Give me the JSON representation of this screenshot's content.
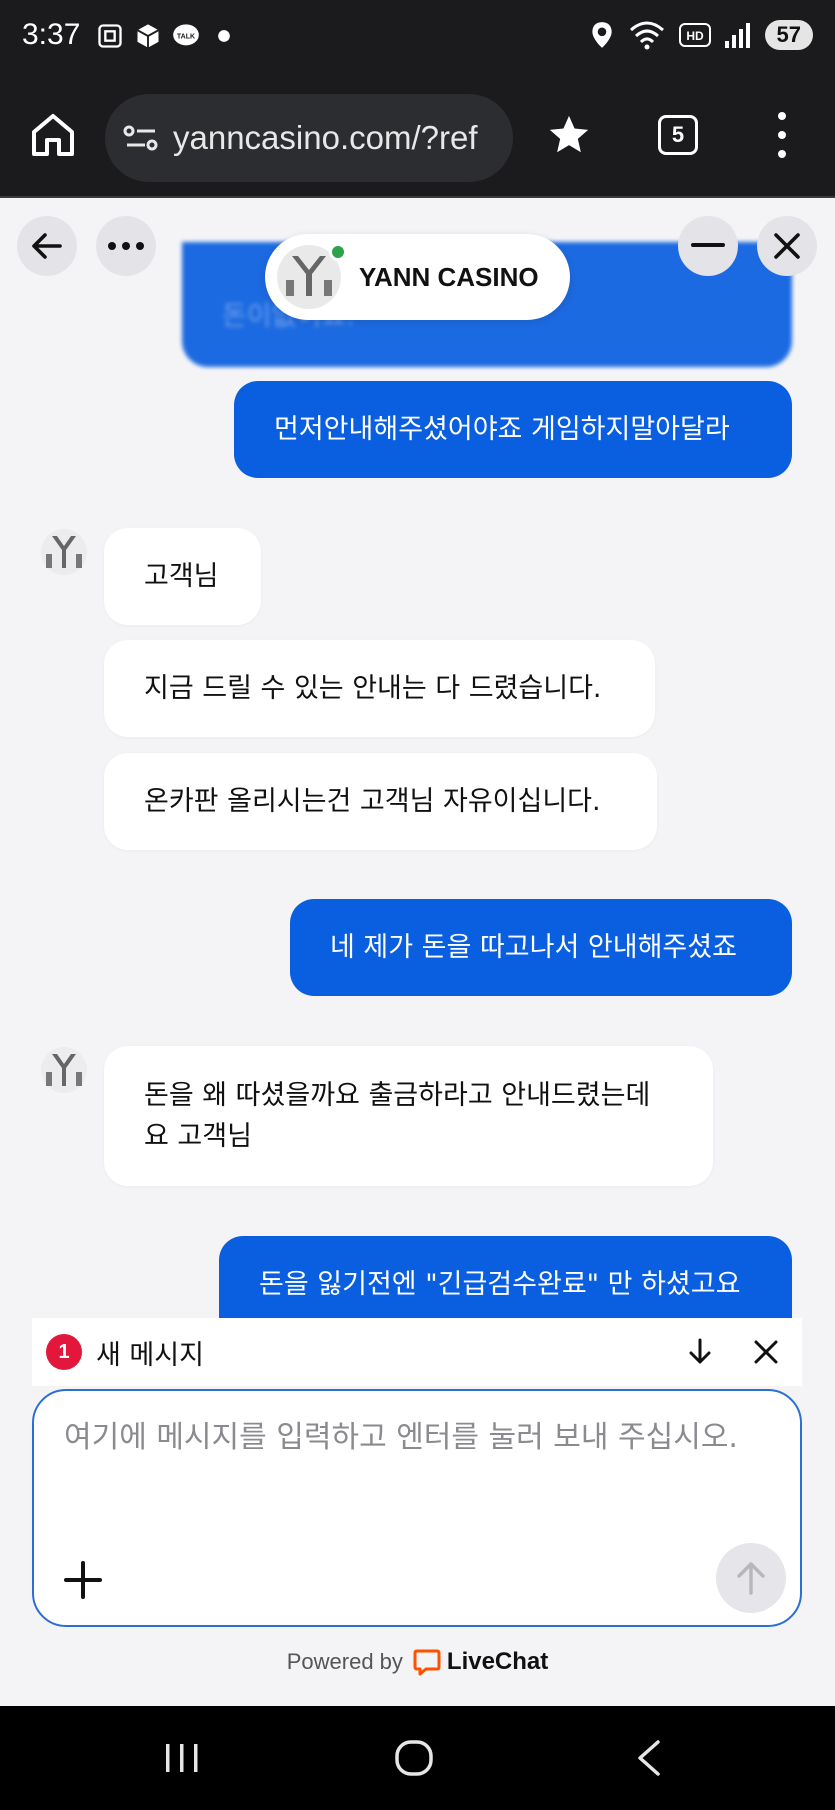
{
  "status_bar": {
    "time": "3:37",
    "battery": "57"
  },
  "browser": {
    "url": "yanncasino.com/?ref",
    "tab_count": "5"
  },
  "chat": {
    "brand_name": "YANN CASINO",
    "messages": [
      {
        "from": "user",
        "text": "돈이없어요."
      },
      {
        "from": "user",
        "text": "먼저안내해주셨어야죠 게임하지말아달라"
      },
      {
        "from": "agent",
        "text": "고객님"
      },
      {
        "from": "agent",
        "text": "지금 드릴 수 있는 안내는 다 드렸습니다."
      },
      {
        "from": "agent",
        "text": "온카판 올리시는건 고객님 자유이십니다."
      },
      {
        "from": "user",
        "text": "네 제가 돈을 따고나서 안내해주셨죠"
      },
      {
        "from": "agent",
        "text": "돈을 왜 따셨을까요 출금하라고 안내드렸는데요 고객님"
      },
      {
        "from": "user",
        "text": "돈을 잃기전엔 \"긴급검수완료\" 만 하셨고요"
      }
    ],
    "new_message": {
      "count": "1",
      "label": "새 메시지"
    },
    "composer": {
      "placeholder": "여기에 메시지를 입력하고 엔터를 눌러 보내 주십시오."
    },
    "powered_by": "Powered by",
    "powered_brand": "LiveChat"
  },
  "colors": {
    "user_bubble": "#0a5fe0",
    "agent_bubble": "#ffffff",
    "badge": "#e2173b",
    "online": "#2aa34a",
    "livechat_orange": "#ff5100"
  }
}
